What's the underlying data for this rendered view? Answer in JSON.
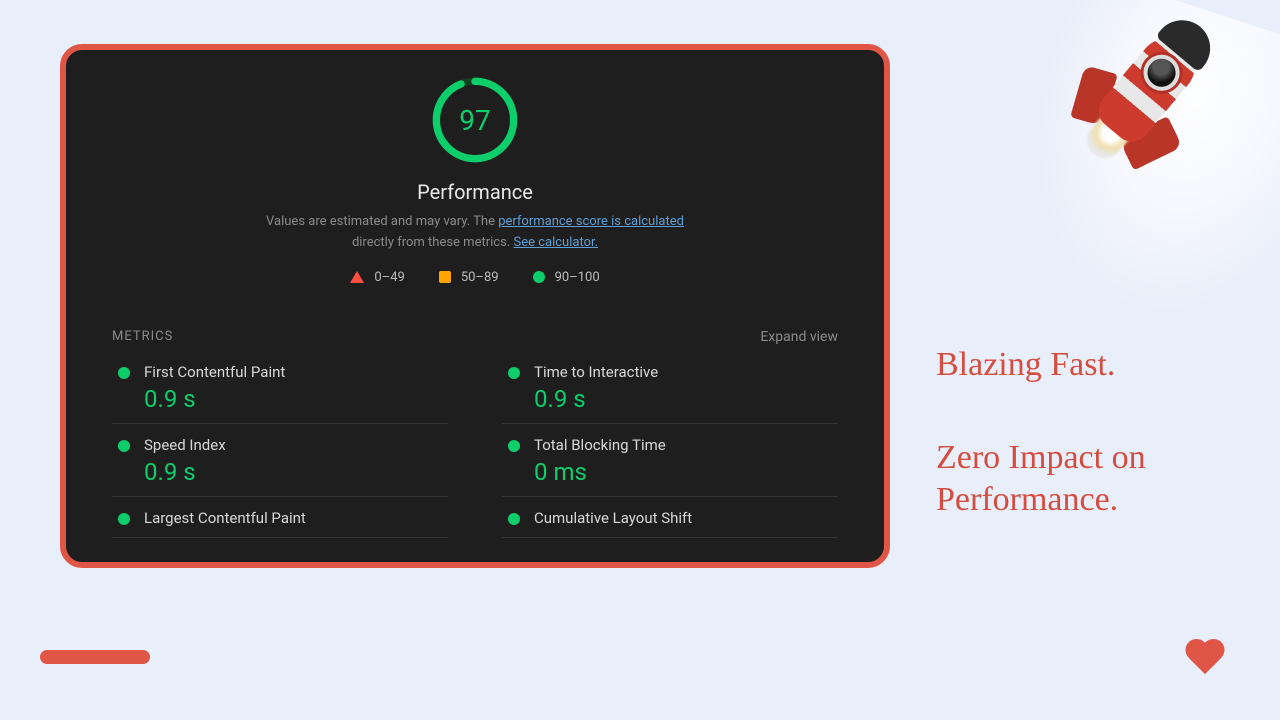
{
  "report": {
    "score": "97",
    "title": "Performance",
    "desc_prefix": "Values are estimated and may vary. The ",
    "link1": "performance score is calculated",
    "desc_mid": " directly from these metrics. ",
    "link2": "See calculator.",
    "legend": {
      "bad": "0–49",
      "mid": "50–89",
      "good": "90–100"
    },
    "metrics_label": "Metrics",
    "expand_label": "Expand view",
    "metrics": [
      {
        "name": "First Contentful Paint",
        "value": "0.9 s"
      },
      {
        "name": "Time to Interactive",
        "value": "0.9 s"
      },
      {
        "name": "Speed Index",
        "value": "0.9 s"
      },
      {
        "name": "Total Blocking Time",
        "value": "0 ms"
      },
      {
        "name": "Largest Contentful Paint",
        "value": ""
      },
      {
        "name": "Cumulative Layout Shift",
        "value": ""
      }
    ]
  },
  "copy": {
    "line1": "Blazing Fast.",
    "line2": "Zero Impact on Performance."
  },
  "colors": {
    "accent": "#e05646",
    "good": "#0cce6b",
    "mid": "#ffa400",
    "bad": "#ff4e42"
  }
}
